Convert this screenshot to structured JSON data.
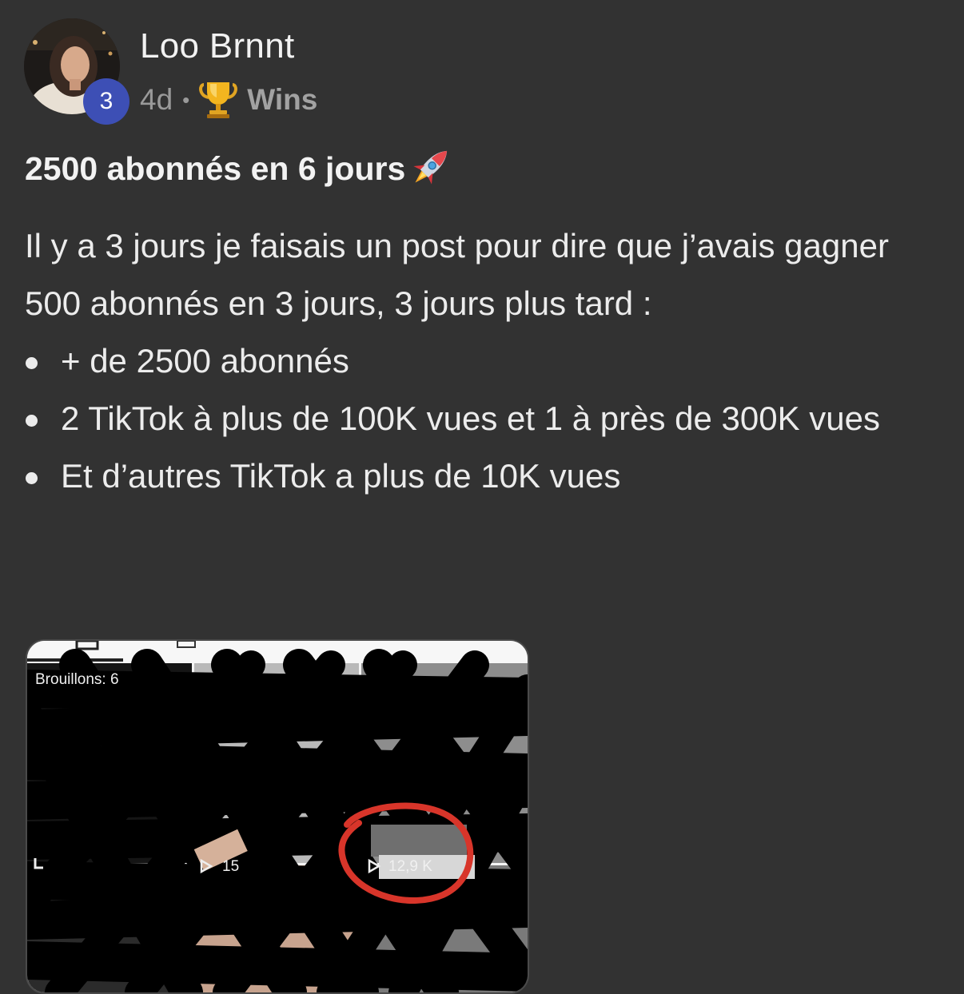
{
  "post": {
    "author": {
      "name": "Loo Brnnt",
      "level": "3",
      "avatar_icon": "profile-photo"
    },
    "meta": {
      "time_ago": "4d",
      "separator": "•",
      "category_icon": "trophy-icon",
      "category": "Wins"
    },
    "title": "2500 abonnés en 6 jours",
    "title_icon": "rocket-icon",
    "paragraph": "Il y a 3 jours je faisais un post pour dire que j’avais gagner 500 abonnés en 3 jours, 3 jours plus tard :",
    "bullets": [
      "+ de 2500 abonnés",
      "2 TikTok à plus de 100K vues et 1 à près de 300K vues",
      "Et d’autres TikTok a plus de 10K vues"
    ],
    "attachment": {
      "drafts_label": "Brouillons: 6",
      "views_partial": "15",
      "views_circled": "12,9 K",
      "circle_color": "#d8352a"
    }
  },
  "colors": {
    "background": "#323232",
    "text": "#ececec",
    "meta": "#9a9a9a",
    "badge": "#3d4fb5"
  }
}
